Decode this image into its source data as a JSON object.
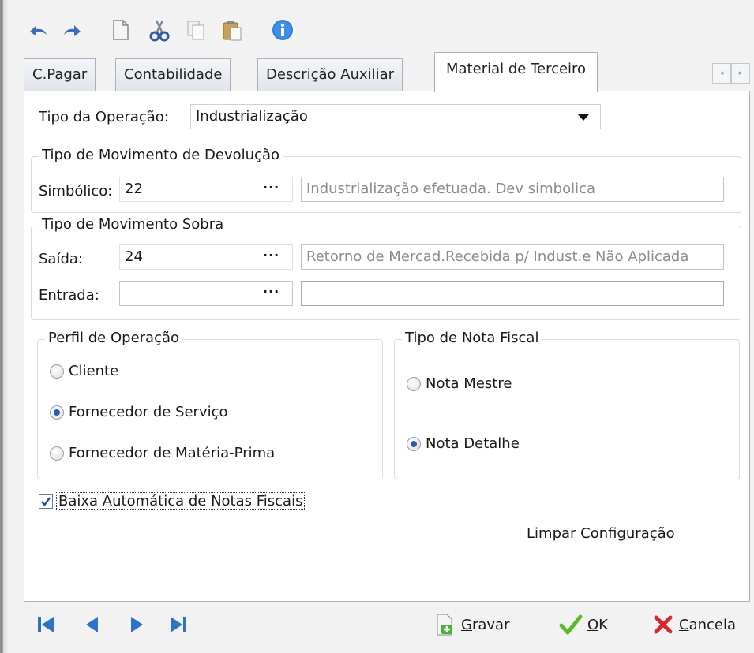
{
  "toolbar": {
    "icons": [
      "undo-icon",
      "redo-icon",
      "new-document-icon",
      "cut-icon",
      "copy-icon",
      "paste-icon",
      "info-icon"
    ]
  },
  "tabs": {
    "items": [
      "C.Pagar",
      "Contabilidade",
      "Descrição Auxiliar",
      "Material de Terceiro"
    ],
    "active": "Material de Terceiro",
    "scroll_left": "◂",
    "scroll_right": "▸"
  },
  "operation": {
    "label": "Tipo da Operação:",
    "value": "Industrialização"
  },
  "devolucao": {
    "title": "Tipo de Movimento de Devolução",
    "simbolico_label": "Simbólico:",
    "simbolico_code": "22",
    "simbolico_desc": "Industrialização efetuada. Dev simbolica",
    "ellipsis": "···"
  },
  "sobra": {
    "title": "Tipo de Movimento Sobra",
    "saida_label": "Saída:",
    "saida_code": "24",
    "saida_desc": "Retorno de Mercad.Recebida p/ Indust.e Não Aplicada",
    "entrada_label": "Entrada:",
    "entrada_code": "",
    "entrada_desc": ""
  },
  "perfil": {
    "title": "Perfil de Operação",
    "options": [
      "Cliente",
      "Fornecedor de Serviço",
      "Fornecedor de Matéria-Prima"
    ],
    "selected": "Fornecedor de Serviço"
  },
  "nota": {
    "title": "Tipo de Nota Fiscal",
    "options": [
      "Nota Mestre",
      "Nota Detalhe"
    ],
    "selected": "Nota Detalhe"
  },
  "baixa": {
    "label": "Baixa Automática de Notas Fiscais",
    "checked": true
  },
  "limpar": {
    "first": "L",
    "rest": "impar Configuração"
  },
  "footer": {
    "gravar_first": "G",
    "gravar_rest": "ravar",
    "ok_first": "O",
    "ok_rest": "K",
    "cancela_first": "C",
    "cancela_rest": "ancela"
  },
  "colors": {
    "accent": "#2a5db0",
    "ok_green": "#5db82e",
    "cancel_red": "#d8262b",
    "nav_blue": "#2f72c9"
  }
}
